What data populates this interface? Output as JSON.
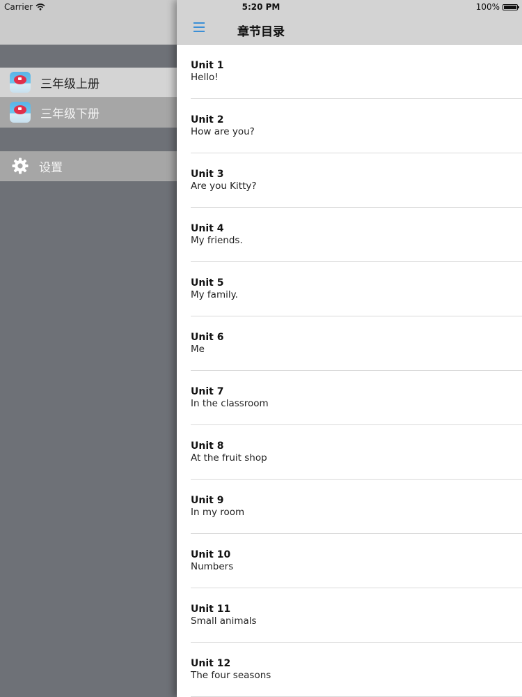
{
  "status_bar": {
    "carrier": "Carrier",
    "time": "5:20 PM",
    "battery": "100%",
    "battery_level": 1.0
  },
  "side_menu": {
    "books": [
      {
        "label": "三年级上册",
        "icon": "book-cover-icon",
        "selected": true
      },
      {
        "label": "三年级下册",
        "icon": "book-cover-icon",
        "selected": false
      }
    ],
    "settings": {
      "label": "设置",
      "icon": "gear-icon"
    }
  },
  "nav": {
    "title": "章节目录",
    "menu_icon": "hamburger-icon",
    "accent_color": "#3b8fd6"
  },
  "units": [
    {
      "title": "Unit 1",
      "subtitle": "Hello!"
    },
    {
      "title": "Unit 2",
      "subtitle": "How are you?"
    },
    {
      "title": "Unit 3",
      "subtitle": "Are you Kitty?"
    },
    {
      "title": "Unit 4",
      "subtitle": "My friends."
    },
    {
      "title": "Unit 5",
      "subtitle": "My family."
    },
    {
      "title": "Unit 6",
      "subtitle": "Me"
    },
    {
      "title": "Unit 7",
      "subtitle": "In the classroom"
    },
    {
      "title": "Unit 8",
      "subtitle": "At the fruit shop"
    },
    {
      "title": "Unit 9",
      "subtitle": "In my room"
    },
    {
      "title": "Unit 10",
      "subtitle": "Numbers"
    },
    {
      "title": "Unit 11",
      "subtitle": "Small animals"
    },
    {
      "title": "Unit 12",
      "subtitle": "The four seasons"
    }
  ]
}
